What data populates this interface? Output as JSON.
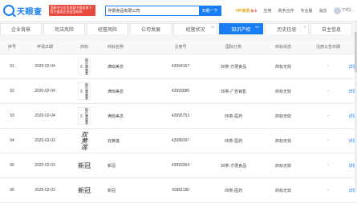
{
  "header": {
    "logo_text": "天眼查",
    "promo_line1": "国家中小企业发展子基金旗下",
    "promo_line2": "官方备案企业征信机构",
    "search_value": "仲景食品有限公司",
    "search_button": "天眼一下",
    "vip_label": "VIP会员",
    "vip_badge": "年卡",
    "nav": [
      "应用",
      "商务合作",
      "专业版",
      "消息",
      "TYO..."
    ]
  },
  "tabs": [
    {
      "label": "企业背景",
      "count": ""
    },
    {
      "label": "司法风险",
      "count": ""
    },
    {
      "label": "经营风险",
      "count": ""
    },
    {
      "label": "公司发展",
      "count": ""
    },
    {
      "label": "经营状况",
      "count": "39"
    },
    {
      "label": "知识产权",
      "count": "99+",
      "active": true
    },
    {
      "label": "历史信息",
      "count": "9"
    },
    {
      "label": "自主信息",
      "count": ""
    }
  ],
  "table": {
    "columns": [
      "序号",
      "申请日期",
      "商标",
      "商标名称",
      "注册号",
      "国际分类",
      "商标状态",
      "注册公告日期",
      ""
    ],
    "rows": [
      {
        "idx": "91",
        "date": "2020-02-04",
        "mark": "保 尔 康 美 食 汇",
        "mark_style": "img",
        "name": "满晾美息",
        "reg": "43994167",
        "cls": "30类-方便食品",
        "status": "商标无效",
        "pub": "-",
        "action": "详情"
      },
      {
        "idx": "92",
        "date": "2020-02-04",
        "mark": "保 尔 康 美 食 汇",
        "mark_style": "img",
        "name": "满晾美息",
        "reg": "43993086",
        "cls": "35类-广告销售",
        "status": "商标无效",
        "pub": "-",
        "action": "详情"
      },
      {
        "idx": "93",
        "date": "2020-02-04",
        "mark": "保 尔 康 美 食 汇",
        "mark_style": "img",
        "name": "满晾美息",
        "reg": "43995753",
        "cls": "05类-医药",
        "status": "商标无效",
        "pub": "-",
        "action": "详情"
      },
      {
        "idx": "94",
        "date": "2020-02-03",
        "mark": "双黄莲",
        "mark_style": "calli",
        "name": "双黄莲",
        "reg": "43986397",
        "cls": "05类-医药",
        "status": "商标无效",
        "pub": "-",
        "action": "详情"
      },
      {
        "idx": "95",
        "date": "2020-02-03",
        "mark": "新冠",
        "mark_style": "wide",
        "name": "新冠",
        "reg": "43993364",
        "cls": "30类-方便食品",
        "status": "商标无效",
        "pub": "-",
        "action": "详情"
      },
      {
        "idx": "96",
        "date": "2020-02-03",
        "mark": "新冠",
        "mark_style": "wide",
        "name": "新冠",
        "reg": "43981180",
        "cls": "05类-医药",
        "status": "商标无效",
        "pub": "-",
        "action": "详情"
      }
    ]
  },
  "colors": {
    "accent": "#1a7ef2",
    "promo": "#e84a3d",
    "vip": "#e8a20f"
  }
}
